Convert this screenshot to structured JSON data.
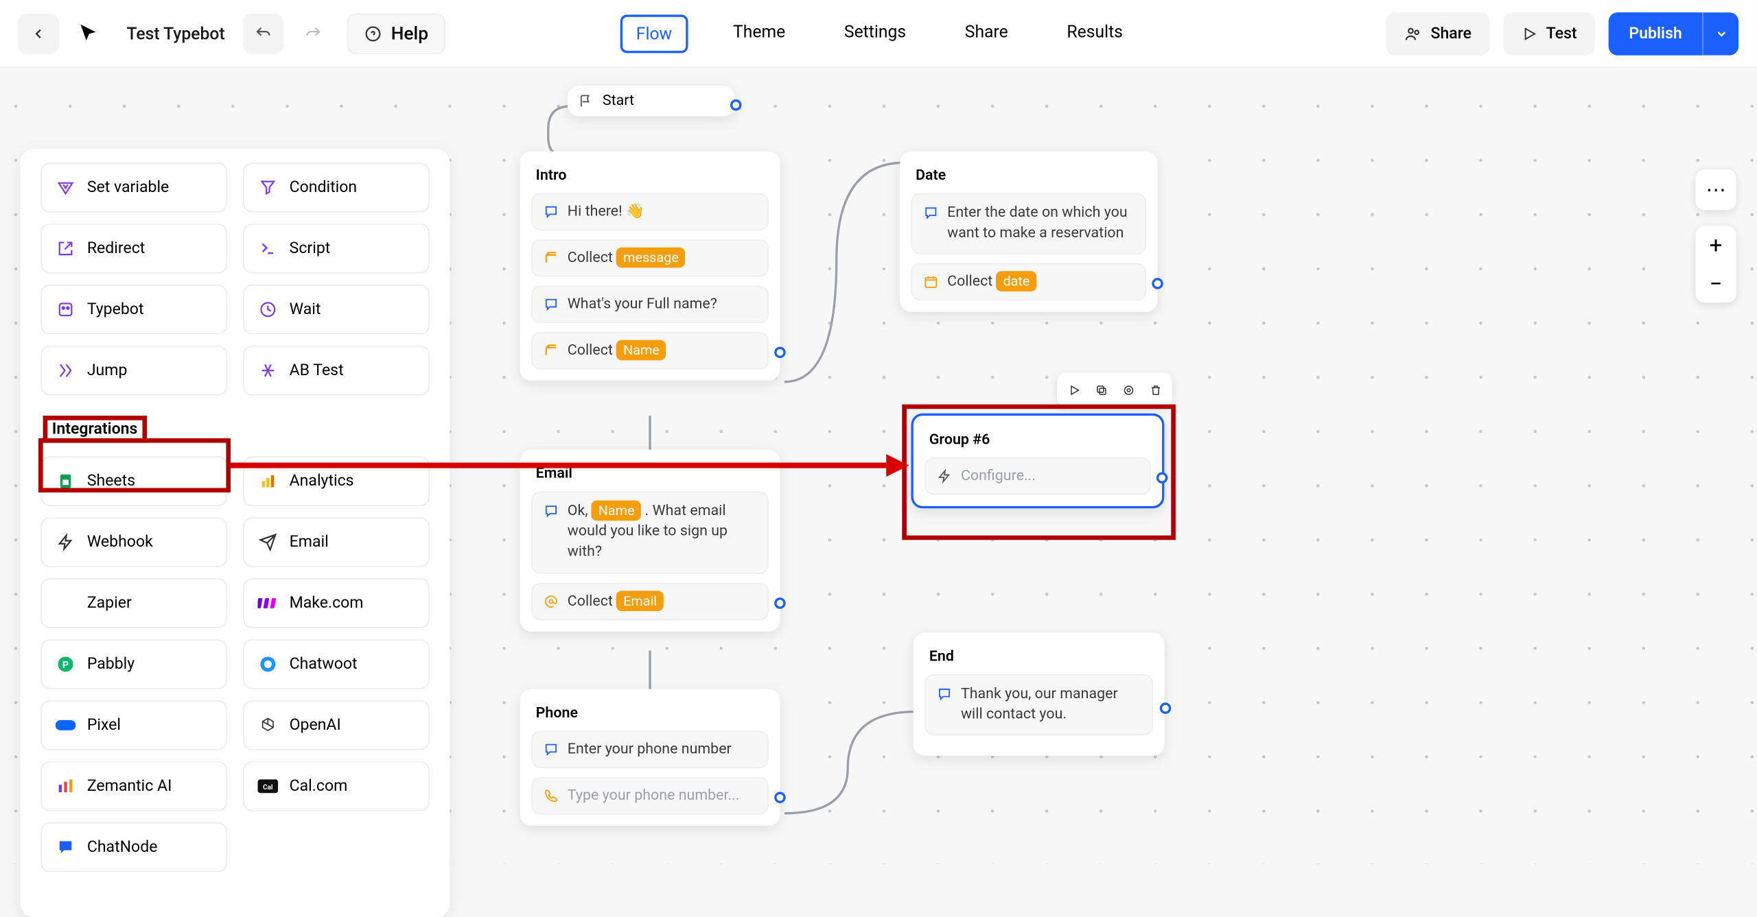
{
  "header": {
    "title": "Test Typebot",
    "tabs": [
      "Flow",
      "Theme",
      "Settings",
      "Share",
      "Results"
    ],
    "active_tab": "Flow",
    "share_label": "Share",
    "test_label": "Test",
    "publish_label": "Publish",
    "help_label": "Help"
  },
  "sidebar": {
    "logic": [
      {
        "icon": "setvar",
        "label": "Set variable"
      },
      {
        "icon": "condition",
        "label": "Condition"
      },
      {
        "icon": "redirect",
        "label": "Redirect"
      },
      {
        "icon": "script",
        "label": "Script"
      },
      {
        "icon": "typebot",
        "label": "Typebot"
      },
      {
        "icon": "wait",
        "label": "Wait"
      },
      {
        "icon": "jump",
        "label": "Jump"
      },
      {
        "icon": "abtest",
        "label": "AB Test"
      }
    ],
    "section_label": "Integrations",
    "integrations": [
      {
        "icon": "sheets",
        "label": "Sheets"
      },
      {
        "icon": "analytics",
        "label": "Analytics"
      },
      {
        "icon": "webhook",
        "label": "Webhook"
      },
      {
        "icon": "email",
        "label": "Email"
      },
      {
        "icon": "zapier",
        "label": "Zapier"
      },
      {
        "icon": "make",
        "label": "Make.com"
      },
      {
        "icon": "pabbly",
        "label": "Pabbly"
      },
      {
        "icon": "chatwoot",
        "label": "Chatwoot"
      },
      {
        "icon": "pixel",
        "label": "Pixel"
      },
      {
        "icon": "openai",
        "label": "OpenAI"
      },
      {
        "icon": "zemantic",
        "label": "Zemantic AI"
      },
      {
        "icon": "calcom",
        "label": "Cal.com"
      },
      {
        "icon": "chatnode",
        "label": "ChatNode"
      }
    ]
  },
  "nodes": {
    "start": {
      "label": "Start"
    },
    "intro": {
      "title": "Intro",
      "b1": "Hi there!",
      "b1_emoji": "👋",
      "b2_prefix": "Collect",
      "b2_chip": "message",
      "b3": "What's your Full name?",
      "b4_prefix": "Collect",
      "b4_chip": "Name"
    },
    "email": {
      "title": "Email",
      "b1_pre": "Ok, ",
      "b1_chip": "Name",
      "b1_post": " . What email would you like to sign up with?",
      "b2_prefix": "Collect",
      "b2_chip": "Email"
    },
    "phone": {
      "title": "Phone",
      "b1": "Enter your phone number",
      "b2_placeholder": "Type your phone number..."
    },
    "date": {
      "title": "Date",
      "b1": "Enter the date on which you want to make a reservation",
      "b2_prefix": "Collect",
      "b2_chip": "date"
    },
    "group6": {
      "title": "Group #6",
      "b1": "Configure..."
    },
    "end": {
      "title": "End",
      "b1": "Thank you, our manager will contact you."
    }
  }
}
